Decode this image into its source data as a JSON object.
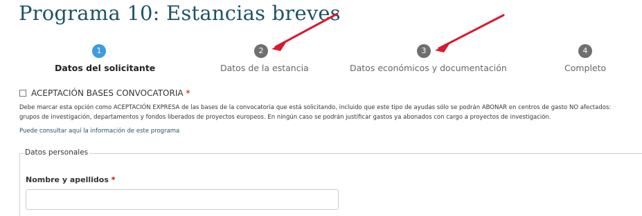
{
  "page_title": "Programa 10: Estancias breves",
  "steps": [
    {
      "number": "1",
      "label": "Datos del solicitante",
      "state": "active"
    },
    {
      "number": "2",
      "label": "Datos de la estancia",
      "state": "pending"
    },
    {
      "number": "3",
      "label": "Datos económicos y documentación",
      "state": "pending"
    },
    {
      "number": "4",
      "label": "Completo",
      "state": "pending"
    }
  ],
  "acceptance": {
    "label": "ACEPTACIÓN BASES CONVOCATORIA",
    "required_mark": "*",
    "checked": false,
    "description": "Debe marcar esta opción como ACEPTACIÓN EXPRESA de las bases de la convocatoria que está solicitando, incluido que este tipo de ayudas sólo se podrán ABONAR en centros de gasto NO afectados: grupos de investigación, departamentos y fondos liberados de proyectos europeos. En ningún caso se podrán justificar gastos ya abonados con cargo a proyectos de investigación.",
    "link_text": "Puede consultar aquí la información de este programa"
  },
  "personal_data": {
    "legend": "Datos personales",
    "name_label": "Nombre y apellidos",
    "required_mark": "*",
    "name_value": ""
  },
  "colors": {
    "title": "#1d5466",
    "active_step": "#3d9be0",
    "pending_step": "#6f6f6f",
    "required": "#cc0000",
    "annotation_arrow": "#d8192e"
  }
}
